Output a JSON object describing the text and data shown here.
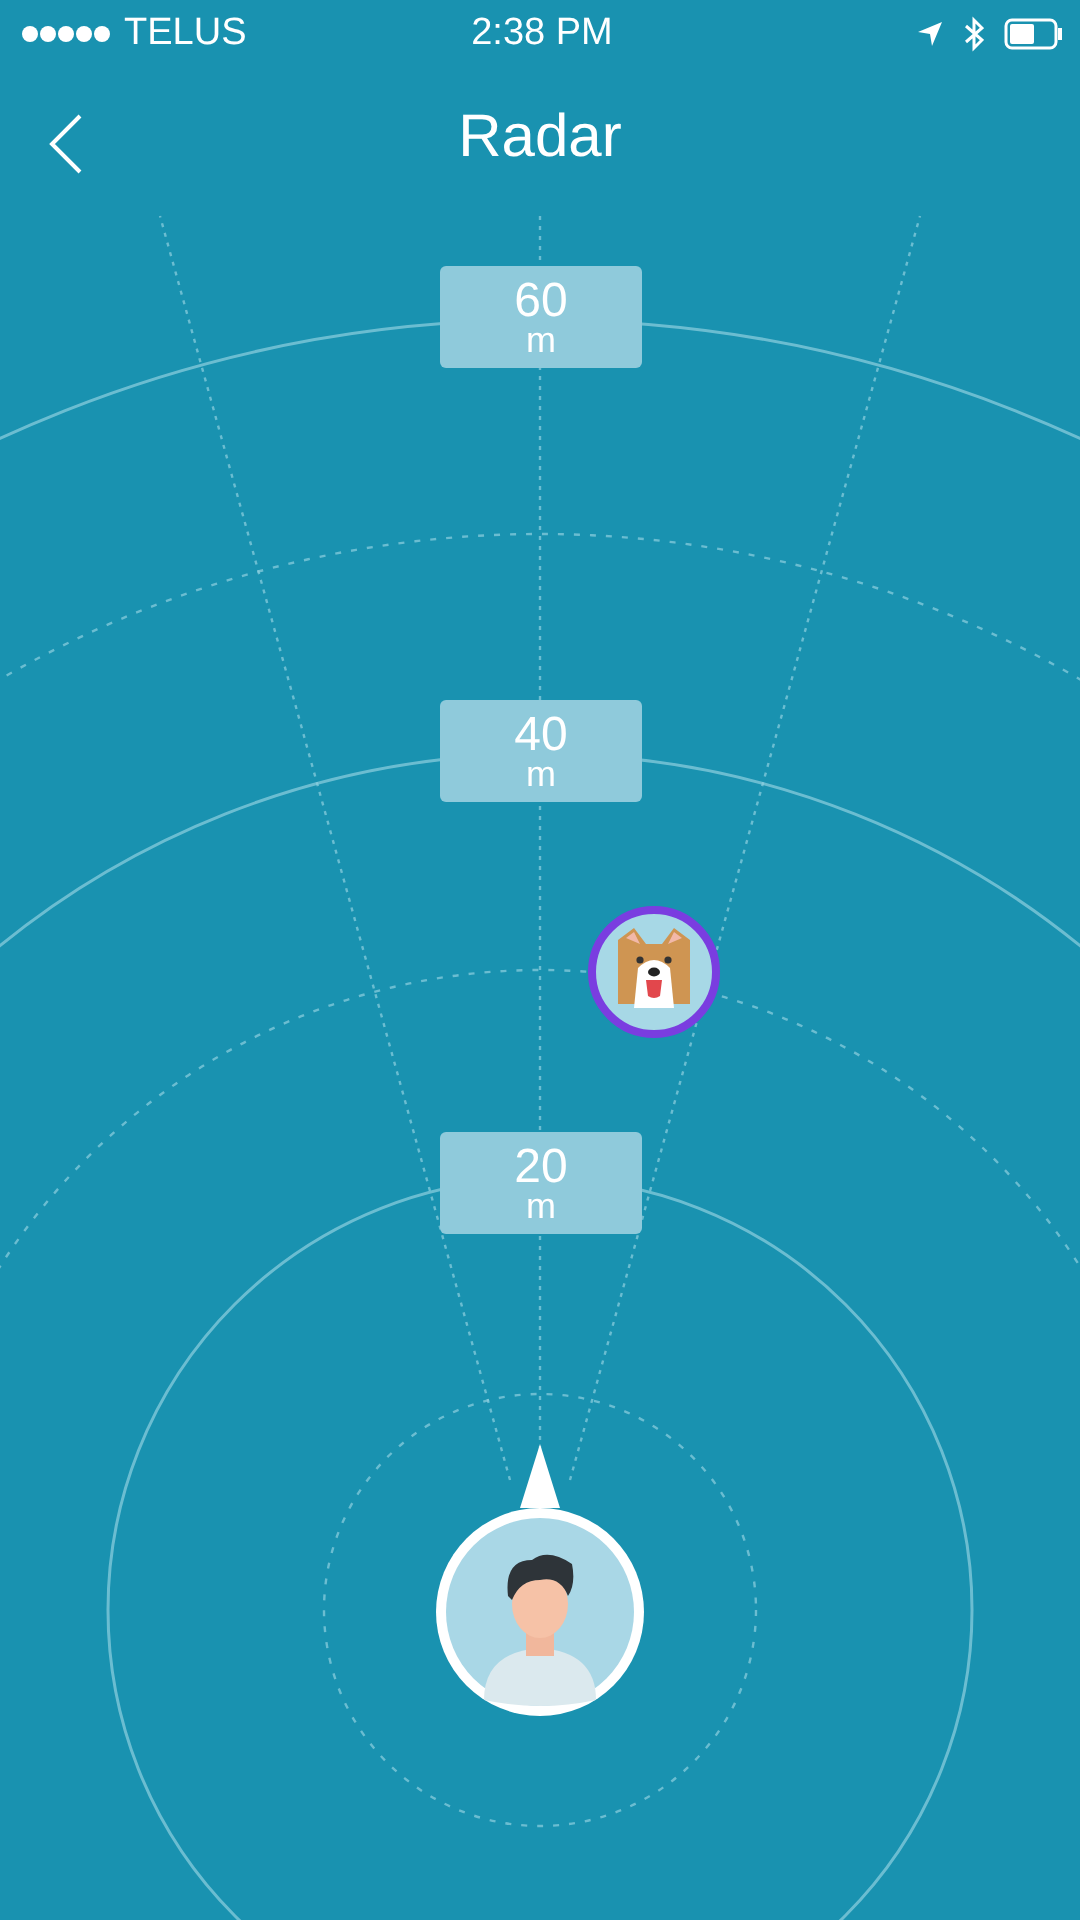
{
  "status_bar": {
    "carrier": "TELUS",
    "time": "2:38 PM"
  },
  "nav": {
    "title": "Radar"
  },
  "range_labels": [
    {
      "value": "60",
      "unit": "m"
    },
    {
      "value": "40",
      "unit": "m"
    },
    {
      "value": "20",
      "unit": "m"
    }
  ]
}
